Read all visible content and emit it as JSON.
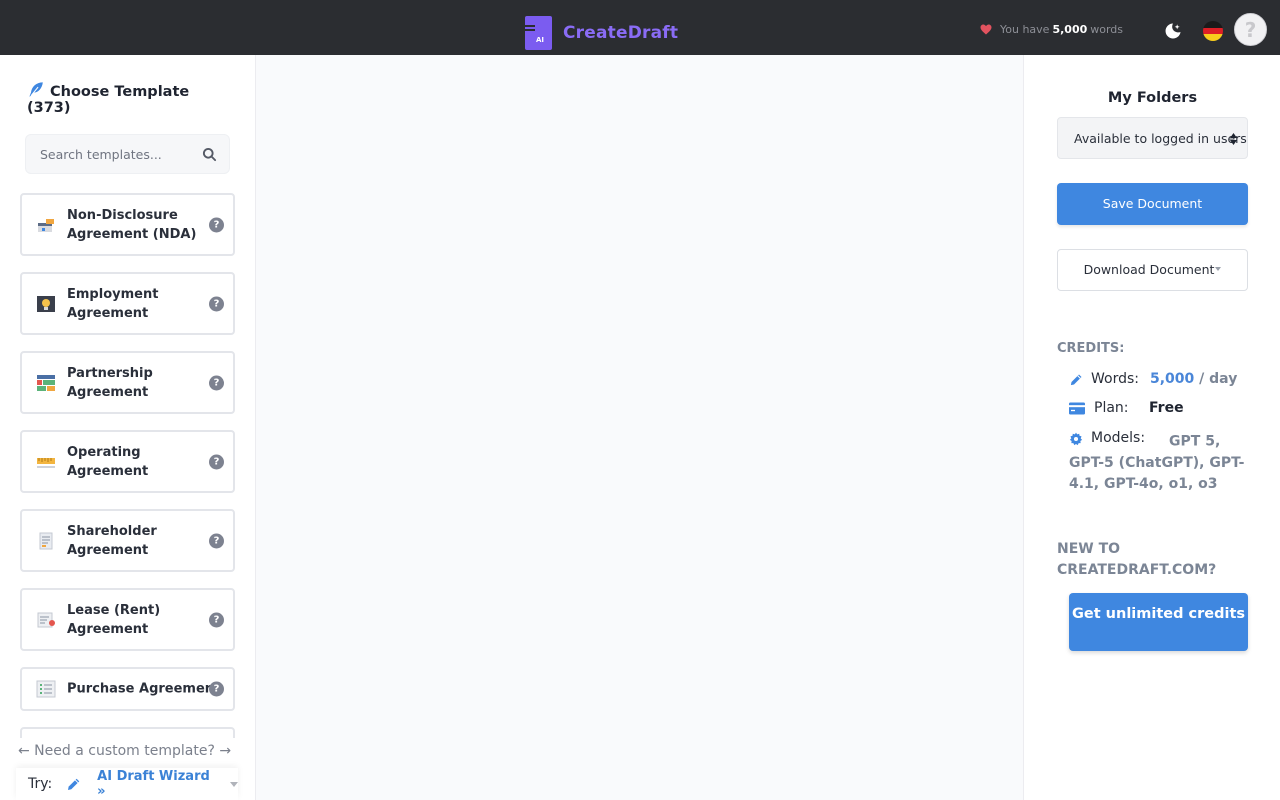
{
  "header": {
    "brand_name": "CreateDraft",
    "brand_logo_text": "AI",
    "words_prefix": "You have",
    "words_count": "5,000",
    "words_suffix": "words",
    "accent_color": "#7b5cf0"
  },
  "sidebar": {
    "title": "Choose Template (373)",
    "search_placeholder": "Search templates...",
    "templates": [
      {
        "label": "Non-Disclosure Agreement (NDA)",
        "icon": "nda-icon"
      },
      {
        "label": "Employment Agreement",
        "icon": "lightbulb-icon"
      },
      {
        "label": "Partnership Agreement",
        "icon": "grid-icon"
      },
      {
        "label": "Operating Agreement",
        "icon": "ruler-icon"
      },
      {
        "label": "Shareholder Agreement",
        "icon": "document-icon"
      },
      {
        "label": "Lease (Rent) Agreement",
        "icon": "receipt-icon"
      },
      {
        "label": "Purchase Agreement",
        "icon": "checklist-icon"
      }
    ],
    "custom_template_link": "← Need a custom template? →",
    "try_label": "Try:",
    "wizard_label": "AI Draft Wizard »"
  },
  "right_panel": {
    "folders_title": "My Folders",
    "folder_select_value": "Available to logged in users",
    "save_button": "Save Document",
    "download_button": "Download Document",
    "credits_heading": "CREDITS:",
    "words_label": "Words:",
    "words_value": "5,000",
    "words_per": " / day",
    "plan_label": "Plan:",
    "plan_value": "Free",
    "models_label": "Models:",
    "models_value": "GPT 5, GPT-5 (ChatGPT), GPT-4.1, GPT-4o, o1, o3",
    "new_to_heading": "NEW TO CREATEDRAFT.COM?",
    "unlimited_button": "Get unlimited credits"
  }
}
